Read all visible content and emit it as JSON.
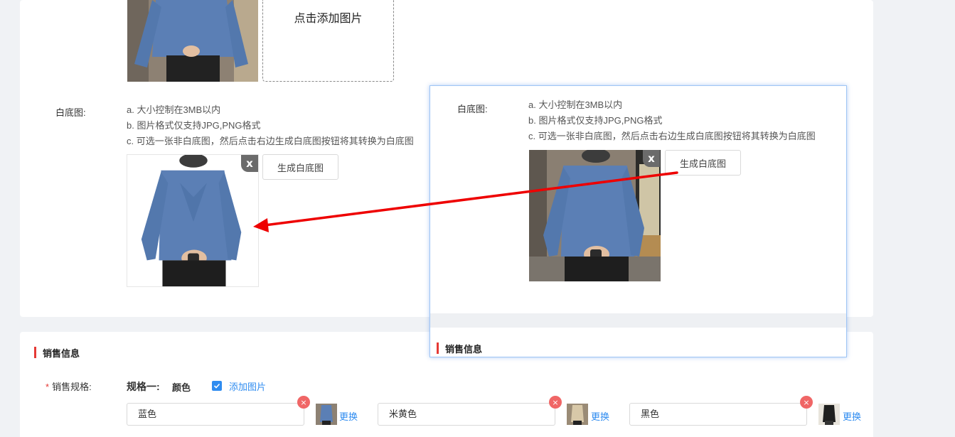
{
  "upload": {
    "add_image_label": "点击添加图片"
  },
  "white_bg": {
    "label": "白底图:",
    "hints": [
      "a. 大小控制在3MB以内",
      "b. 图片格式仅支持JPG,PNG格式",
      "c. 可选一张非白底图，然后点击右边生成白底图按钮将其转换为白底图"
    ],
    "close_label": "x",
    "generate_button": "生成白底图"
  },
  "popup": {
    "label": "白底图:",
    "hints": [
      "a. 大小控制在3MB以内",
      "b. 图片格式仅支持JPG,PNG格式",
      "c. 可选一张非白底图，然后点击右边生成白底图按钮将其转换为白底图"
    ],
    "close_label": "x",
    "generate_button": "生成白底图",
    "section_title": "销售信息"
  },
  "sales": {
    "section_title": "销售信息",
    "spec_label": "销售规格:",
    "required_mark": "*",
    "spec_one_label": "规格一:",
    "spec_one_name": "颜色",
    "add_image_label": "添加图片",
    "colors": [
      {
        "value": "蓝色",
        "replace": "更换",
        "remove": "×"
      },
      {
        "value": "米黄色",
        "replace": "更换",
        "remove": "×"
      },
      {
        "value": "黑色",
        "replace": "更换",
        "remove": "×"
      }
    ]
  },
  "colors": {
    "accent": "#2f8cf0",
    "required": "#e53935",
    "arrow": "#ee0000",
    "sweater_blue": "#5b7fb5"
  }
}
